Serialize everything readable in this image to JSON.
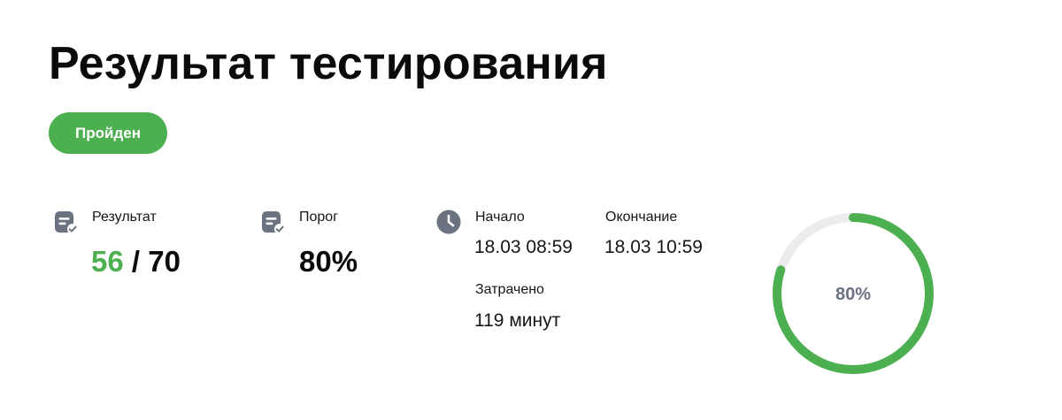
{
  "page": {
    "title": "Результат тестирования",
    "status": "Пройден"
  },
  "colors": {
    "success": "#4caf50",
    "icon": "#6b7280",
    "track": "#ececef"
  },
  "stats": {
    "result": {
      "icon": "document-check-icon",
      "label": "Результат",
      "score": "56",
      "separator": " / ",
      "total": "70"
    },
    "threshold": {
      "icon": "document-check-icon",
      "label": "Порог",
      "value": "80%"
    },
    "time": {
      "icon": "clock-icon",
      "start_label": "Начало",
      "start_value": "18.03 08:59",
      "end_label": "Окончание",
      "end_value": "18.03 10:59",
      "spent_label": "Затрачено",
      "spent_value": "119 минут"
    }
  },
  "gauge": {
    "percent": 80,
    "label": "80%"
  }
}
